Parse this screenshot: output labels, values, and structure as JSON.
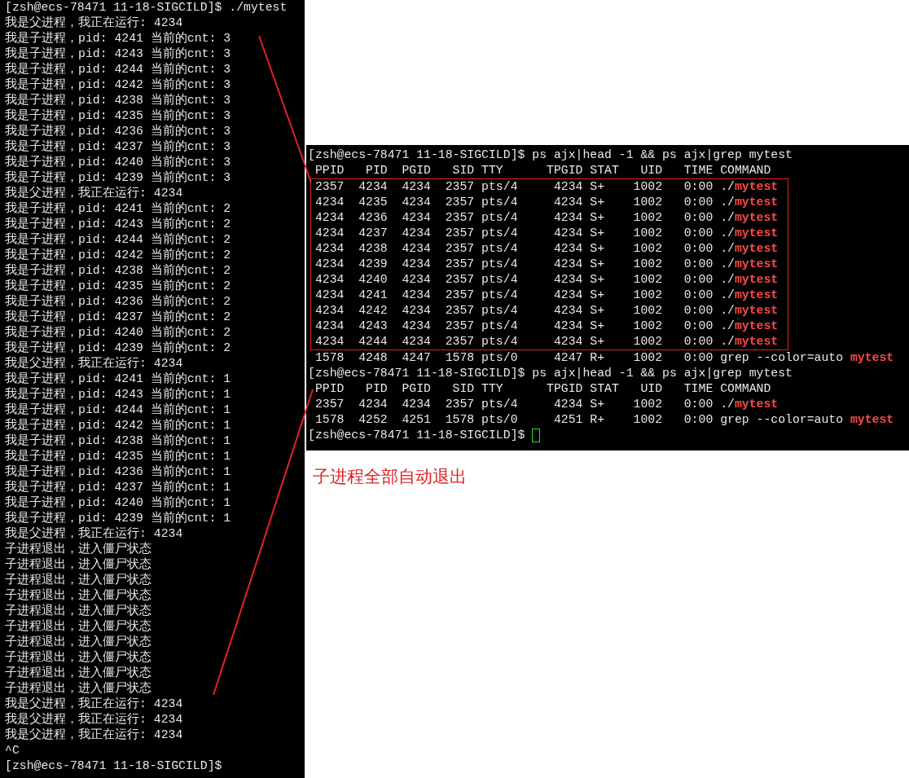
{
  "left_terminal": {
    "lines": [
      "[zsh@ecs-78471 11-18-SIGCILD]$ ./mytest",
      "我是父进程，我正在运行: 4234",
      "我是子进程，pid: 4241 当前的cnt: 3",
      "我是子进程，pid: 4243 当前的cnt: 3",
      "我是子进程，pid: 4244 当前的cnt: 3",
      "我是子进程，pid: 4242 当前的cnt: 3",
      "我是子进程，pid: 4238 当前的cnt: 3",
      "我是子进程，pid: 4235 当前的cnt: 3",
      "我是子进程，pid: 4236 当前的cnt: 3",
      "我是子进程，pid: 4237 当前的cnt: 3",
      "我是子进程，pid: 4240 当前的cnt: 3",
      "我是子进程，pid: 4239 当前的cnt: 3",
      "我是父进程，我正在运行: 4234",
      "我是子进程，pid: 4241 当前的cnt: 2",
      "我是子进程，pid: 4243 当前的cnt: 2",
      "我是子进程，pid: 4244 当前的cnt: 2",
      "我是子进程，pid: 4242 当前的cnt: 2",
      "我是子进程，pid: 4238 当前的cnt: 2",
      "我是子进程，pid: 4235 当前的cnt: 2",
      "我是子进程，pid: 4236 当前的cnt: 2",
      "我是子进程，pid: 4237 当前的cnt: 2",
      "我是子进程，pid: 4240 当前的cnt: 2",
      "我是子进程，pid: 4239 当前的cnt: 2",
      "我是父进程，我正在运行: 4234",
      "我是子进程，pid: 4241 当前的cnt: 1",
      "我是子进程，pid: 4243 当前的cnt: 1",
      "我是子进程，pid: 4244 当前的cnt: 1",
      "我是子进程，pid: 4242 当前的cnt: 1",
      "我是子进程，pid: 4238 当前的cnt: 1",
      "我是子进程，pid: 4235 当前的cnt: 1",
      "我是子进程，pid: 4236 当前的cnt: 1",
      "我是子进程，pid: 4237 当前的cnt: 1",
      "我是子进程，pid: 4240 当前的cnt: 1",
      "我是子进程，pid: 4239 当前的cnt: 1",
      "我是父进程，我正在运行: 4234",
      "子进程退出，进入僵尸状态",
      "子进程退出，进入僵尸状态",
      "子进程退出，进入僵尸状态",
      "子进程退出，进入僵尸状态",
      "子进程退出，进入僵尸状态",
      "子进程退出，进入僵尸状态",
      "子进程退出，进入僵尸状态",
      "子进程退出，进入僵尸状态",
      "子进程退出，进入僵尸状态",
      "子进程退出，进入僵尸状态",
      "我是父进程，我正在运行: 4234",
      "我是父进程，我正在运行: 4234",
      "我是父进程，我正在运行: 4234",
      "^C",
      "[zsh@ecs-78471 11-18-SIGCILD]$"
    ]
  },
  "right_terminal": {
    "blocks": [
      {
        "kind": "prompt",
        "text": "[zsh@ecs-78471 11-18-SIGCILD]$ ps ajx|head -1 && ps ajx|grep mytest",
        "cursor": false
      },
      {
        "kind": "header",
        "text": " PPID   PID  PGID   SID TTY      TPGID STAT   UID   TIME COMMAND"
      },
      {
        "kind": "rows",
        "boxed": true,
        "rows": [
          {
            "text": " 2357  4234  4234  2357 pts/4     4234 S+    1002   0:00 ./",
            "match": "mytest"
          },
          {
            "text": " 4234  4235  4234  2357 pts/4     4234 S+    1002   0:00 ./",
            "match": "mytest"
          },
          {
            "text": " 4234  4236  4234  2357 pts/4     4234 S+    1002   0:00 ./",
            "match": "mytest"
          },
          {
            "text": " 4234  4237  4234  2357 pts/4     4234 S+    1002   0:00 ./",
            "match": "mytest"
          },
          {
            "text": " 4234  4238  4234  2357 pts/4     4234 S+    1002   0:00 ./",
            "match": "mytest"
          },
          {
            "text": " 4234  4239  4234  2357 pts/4     4234 S+    1002   0:00 ./",
            "match": "mytest"
          },
          {
            "text": " 4234  4240  4234  2357 pts/4     4234 S+    1002   0:00 ./",
            "match": "mytest"
          },
          {
            "text": " 4234  4241  4234  2357 pts/4     4234 S+    1002   0:00 ./",
            "match": "mytest"
          },
          {
            "text": " 4234  4242  4234  2357 pts/4     4234 S+    1002   0:00 ./",
            "match": "mytest"
          },
          {
            "text": " 4234  4243  4234  2357 pts/4     4234 S+    1002   0:00 ./",
            "match": "mytest"
          },
          {
            "text": " 4234  4244  4234  2357 pts/4     4234 S+    1002   0:00 ./",
            "match": "mytest"
          }
        ]
      },
      {
        "kind": "rows",
        "boxed": false,
        "rows": [
          {
            "text": " 1578  4248  4247  1578 pts/0     4247 R+    1002   0:00 grep --color=auto ",
            "match": "mytest"
          }
        ]
      },
      {
        "kind": "prompt",
        "text": "[zsh@ecs-78471 11-18-SIGCILD]$ ps ajx|head -1 && ps ajx|grep mytest",
        "cursor": false
      },
      {
        "kind": "header",
        "text": " PPID   PID  PGID   SID TTY      TPGID STAT   UID   TIME COMMAND"
      },
      {
        "kind": "rows",
        "boxed": false,
        "rows": [
          {
            "text": " 2357  4234  4234  2357 pts/4     4234 S+    1002   0:00 ./",
            "match": "mytest"
          },
          {
            "text": " 1578  4252  4251  1578 pts/0     4251 R+    1002   0:00 grep --color=auto ",
            "match": "mytest"
          }
        ]
      },
      {
        "kind": "prompt",
        "text": "[zsh@ecs-78471 11-18-SIGCILD]$ ",
        "cursor": true
      }
    ]
  },
  "annotation": "子进程全部自动退出"
}
